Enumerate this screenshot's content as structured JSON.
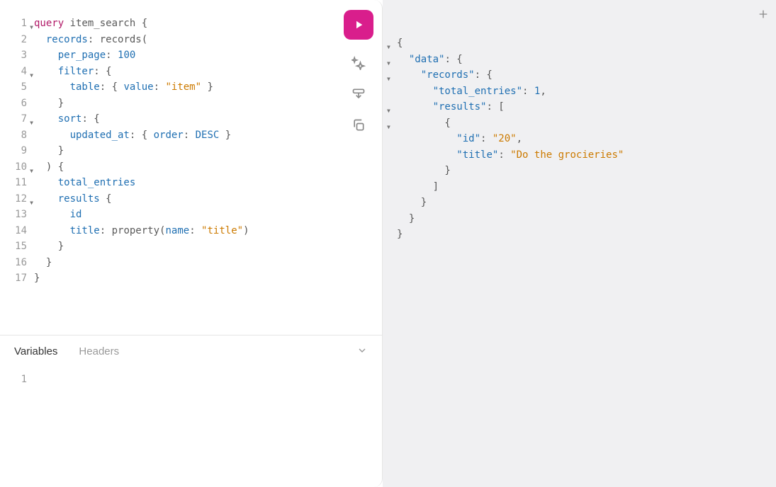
{
  "editor": {
    "lines": [
      {
        "n": "1",
        "fold": true,
        "tokens": [
          {
            "t": "query ",
            "c": "tok-kw"
          },
          {
            "t": "item_search ",
            "c": "tok-id"
          },
          {
            "t": "{",
            "c": "tok-punc"
          }
        ]
      },
      {
        "n": "2",
        "fold": false,
        "tokens": [
          {
            "t": "  ",
            "c": ""
          },
          {
            "t": "records",
            "c": "tok-field"
          },
          {
            "t": ": ",
            "c": "tok-punc"
          },
          {
            "t": "records",
            "c": "tok-id"
          },
          {
            "t": "(",
            "c": "tok-punc"
          }
        ]
      },
      {
        "n": "3",
        "fold": false,
        "tokens": [
          {
            "t": "    ",
            "c": ""
          },
          {
            "t": "per_page",
            "c": "tok-field"
          },
          {
            "t": ": ",
            "c": "tok-punc"
          },
          {
            "t": "100",
            "c": "tok-num"
          }
        ]
      },
      {
        "n": "4",
        "fold": true,
        "tokens": [
          {
            "t": "    ",
            "c": ""
          },
          {
            "t": "filter",
            "c": "tok-field"
          },
          {
            "t": ": {",
            "c": "tok-punc"
          }
        ]
      },
      {
        "n": "5",
        "fold": false,
        "tokens": [
          {
            "t": "      ",
            "c": ""
          },
          {
            "t": "table",
            "c": "tok-field"
          },
          {
            "t": ": { ",
            "c": "tok-punc"
          },
          {
            "t": "value",
            "c": "tok-field"
          },
          {
            "t": ": ",
            "c": "tok-punc"
          },
          {
            "t": "\"item\"",
            "c": "tok-str"
          },
          {
            "t": " }",
            "c": "tok-punc"
          }
        ]
      },
      {
        "n": "6",
        "fold": false,
        "tokens": [
          {
            "t": "    }",
            "c": "tok-punc"
          }
        ]
      },
      {
        "n": "7",
        "fold": true,
        "tokens": [
          {
            "t": "    ",
            "c": ""
          },
          {
            "t": "sort",
            "c": "tok-field"
          },
          {
            "t": ": {",
            "c": "tok-punc"
          }
        ]
      },
      {
        "n": "8",
        "fold": false,
        "tokens": [
          {
            "t": "      ",
            "c": ""
          },
          {
            "t": "updated_at",
            "c": "tok-field"
          },
          {
            "t": ": { ",
            "c": "tok-punc"
          },
          {
            "t": "order",
            "c": "tok-field"
          },
          {
            "t": ": ",
            "c": "tok-punc"
          },
          {
            "t": "DESC",
            "c": "tok-const"
          },
          {
            "t": " }",
            "c": "tok-punc"
          }
        ]
      },
      {
        "n": "9",
        "fold": false,
        "tokens": [
          {
            "t": "    }",
            "c": "tok-punc"
          }
        ]
      },
      {
        "n": "10",
        "fold": true,
        "tokens": [
          {
            "t": "  ) {",
            "c": "tok-punc"
          }
        ]
      },
      {
        "n": "11",
        "fold": false,
        "tokens": [
          {
            "t": "    ",
            "c": ""
          },
          {
            "t": "total_entries",
            "c": "tok-field"
          }
        ]
      },
      {
        "n": "12",
        "fold": true,
        "tokens": [
          {
            "t": "    ",
            "c": ""
          },
          {
            "t": "results",
            "c": "tok-field"
          },
          {
            "t": " {",
            "c": "tok-punc"
          }
        ]
      },
      {
        "n": "13",
        "fold": false,
        "tokens": [
          {
            "t": "      ",
            "c": ""
          },
          {
            "t": "id",
            "c": "tok-field"
          }
        ]
      },
      {
        "n": "14",
        "fold": false,
        "tokens": [
          {
            "t": "      ",
            "c": ""
          },
          {
            "t": "title",
            "c": "tok-field"
          },
          {
            "t": ": ",
            "c": "tok-punc"
          },
          {
            "t": "property",
            "c": "tok-id"
          },
          {
            "t": "(",
            "c": "tok-punc"
          },
          {
            "t": "name",
            "c": "tok-field"
          },
          {
            "t": ": ",
            "c": "tok-punc"
          },
          {
            "t": "\"title\"",
            "c": "tok-str"
          },
          {
            "t": ")",
            "c": "tok-punc"
          }
        ]
      },
      {
        "n": "15",
        "fold": false,
        "tokens": [
          {
            "t": "    }",
            "c": "tok-punc"
          }
        ]
      },
      {
        "n": "16",
        "fold": false,
        "tokens": [
          {
            "t": "  }",
            "c": "tok-punc"
          }
        ]
      },
      {
        "n": "17",
        "fold": false,
        "tokens": [
          {
            "t": "}",
            "c": "tok-punc"
          }
        ]
      }
    ]
  },
  "tabs": {
    "variables": "Variables",
    "headers": "Headers"
  },
  "vars_line": "1",
  "result": {
    "lines": [
      {
        "fold": true,
        "tokens": [
          {
            "t": "{",
            "c": "jp"
          }
        ]
      },
      {
        "fold": true,
        "tokens": [
          {
            "t": "  ",
            "c": ""
          },
          {
            "t": "\"data\"",
            "c": "jk"
          },
          {
            "t": ": {",
            "c": "jp"
          }
        ]
      },
      {
        "fold": true,
        "tokens": [
          {
            "t": "    ",
            "c": ""
          },
          {
            "t": "\"records\"",
            "c": "jk"
          },
          {
            "t": ": {",
            "c": "jp"
          }
        ]
      },
      {
        "fold": false,
        "tokens": [
          {
            "t": "      ",
            "c": ""
          },
          {
            "t": "\"total_entries\"",
            "c": "jk"
          },
          {
            "t": ": ",
            "c": "jp"
          },
          {
            "t": "1",
            "c": "jn"
          },
          {
            "t": ",",
            "c": "jp"
          }
        ]
      },
      {
        "fold": true,
        "tokens": [
          {
            "t": "      ",
            "c": ""
          },
          {
            "t": "\"results\"",
            "c": "jk"
          },
          {
            "t": ": [",
            "c": "jp"
          }
        ]
      },
      {
        "fold": true,
        "tokens": [
          {
            "t": "        {",
            "c": "jp"
          }
        ]
      },
      {
        "fold": false,
        "tokens": [
          {
            "t": "          ",
            "c": ""
          },
          {
            "t": "\"id\"",
            "c": "jk"
          },
          {
            "t": ": ",
            "c": "jp"
          },
          {
            "t": "\"20\"",
            "c": "js"
          },
          {
            "t": ",",
            "c": "jp"
          }
        ]
      },
      {
        "fold": false,
        "tokens": [
          {
            "t": "          ",
            "c": ""
          },
          {
            "t": "\"title\"",
            "c": "jk"
          },
          {
            "t": ": ",
            "c": "jp"
          },
          {
            "t": "\"Do the grocieries\"",
            "c": "js"
          }
        ]
      },
      {
        "fold": false,
        "tokens": [
          {
            "t": "        }",
            "c": "jp"
          }
        ]
      },
      {
        "fold": false,
        "tokens": [
          {
            "t": "      ]",
            "c": "jp"
          }
        ]
      },
      {
        "fold": false,
        "tokens": [
          {
            "t": "    }",
            "c": "jp"
          }
        ]
      },
      {
        "fold": false,
        "tokens": [
          {
            "t": "  }",
            "c": "jp"
          }
        ]
      },
      {
        "fold": false,
        "tokens": [
          {
            "t": "}",
            "c": "jp"
          }
        ]
      }
    ]
  }
}
